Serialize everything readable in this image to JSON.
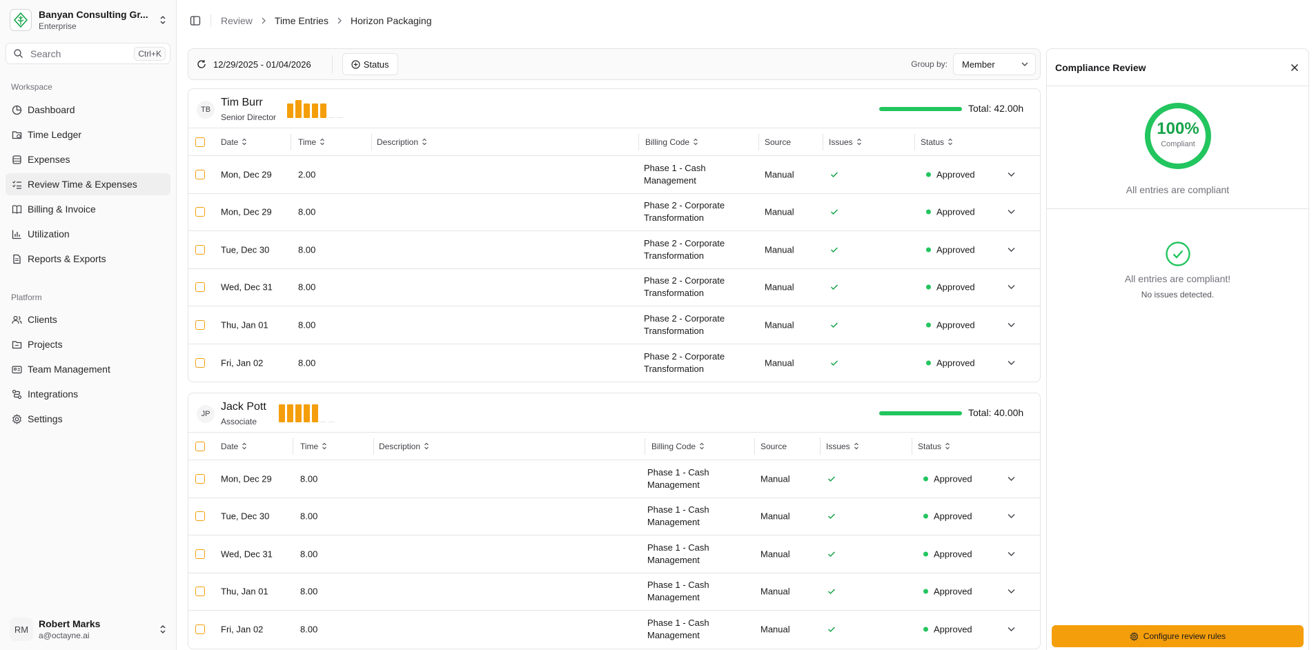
{
  "org": {
    "name": "Banyan Consulting Gr...",
    "plan": "Enterprise"
  },
  "search": {
    "placeholder": "Search",
    "shortcut": "Ctrl+K"
  },
  "sidebar": {
    "workspace_label": "Workspace",
    "platform_label": "Platform",
    "workspace_items": [
      {
        "label": "Dashboard",
        "icon": "chart-pie-icon"
      },
      {
        "label": "Time Ledger",
        "icon": "folder-clock-icon"
      },
      {
        "label": "Expenses",
        "icon": "database-icon"
      },
      {
        "label": "Review Time & Expenses",
        "icon": "list-check-icon"
      },
      {
        "label": "Billing & Invoice",
        "icon": "book-open-icon"
      },
      {
        "label": "Utilization",
        "icon": "chart-bar-icon"
      },
      {
        "label": "Reports & Exports",
        "icon": "file-text-icon"
      }
    ],
    "platform_items": [
      {
        "label": "Clients",
        "icon": "users-icon"
      },
      {
        "label": "Projects",
        "icon": "folder-icon"
      },
      {
        "label": "Team Management",
        "icon": "id-card-icon"
      },
      {
        "label": "Integrations",
        "icon": "integration-icon"
      },
      {
        "label": "Settings",
        "icon": "gear-icon"
      }
    ],
    "active_item": "Review Time & Expenses"
  },
  "user": {
    "initials": "RM",
    "name": "Robert Marks",
    "email": "a@octayne.ai"
  },
  "breadcrumb": [
    "Review",
    "Time Entries",
    "Horizon Packaging"
  ],
  "filters": {
    "date_range": "12/29/2025 - 01/04/2026",
    "status_button": "Status",
    "group_by_label": "Group by:",
    "group_by_value": "Member"
  },
  "columns": [
    "Date",
    "Time",
    "Description",
    "Billing Code",
    "Source",
    "Issues",
    "Status"
  ],
  "groups": [
    {
      "initials": "TB",
      "name": "Tim Burr",
      "role": "Senior Director",
      "total": "Total: 42.00h",
      "progress": 1.0,
      "daily_hours": [
        8,
        10,
        8,
        8,
        8,
        0,
        0
      ],
      "rows": [
        {
          "date": "Mon, Dec 29",
          "time": "2.00",
          "description": "",
          "billing_code": [
            "Phase 1 - Cash",
            "Management"
          ],
          "source": "Manual",
          "status": "Approved"
        },
        {
          "date": "Mon, Dec 29",
          "time": "8.00",
          "description": "",
          "billing_code": [
            "Phase 2 - Corporate",
            "Transformation"
          ],
          "source": "Manual",
          "status": "Approved"
        },
        {
          "date": "Tue, Dec 30",
          "time": "8.00",
          "description": "",
          "billing_code": [
            "Phase 2 - Corporate",
            "Transformation"
          ],
          "source": "Manual",
          "status": "Approved"
        },
        {
          "date": "Wed, Dec 31",
          "time": "8.00",
          "description": "",
          "billing_code": [
            "Phase 2 - Corporate",
            "Transformation"
          ],
          "source": "Manual",
          "status": "Approved"
        },
        {
          "date": "Thu, Jan 01",
          "time": "8.00",
          "description": "",
          "billing_code": [
            "Phase 2 - Corporate",
            "Transformation"
          ],
          "source": "Manual",
          "status": "Approved"
        },
        {
          "date": "Fri, Jan 02",
          "time": "8.00",
          "description": "",
          "billing_code": [
            "Phase 2 - Corporate",
            "Transformation"
          ],
          "source": "Manual",
          "status": "Approved"
        }
      ]
    },
    {
      "initials": "JP",
      "name": "Jack Pott",
      "role": "Associate",
      "total": "Total: 40.00h",
      "progress": 1.0,
      "daily_hours": [
        8,
        8,
        8,
        8,
        8,
        0,
        0
      ],
      "rows": [
        {
          "date": "Mon, Dec 29",
          "time": "8.00",
          "description": "",
          "billing_code": [
            "Phase 1 - Cash",
            "Management"
          ],
          "source": "Manual",
          "status": "Approved"
        },
        {
          "date": "Tue, Dec 30",
          "time": "8.00",
          "description": "",
          "billing_code": [
            "Phase 1 - Cash",
            "Management"
          ],
          "source": "Manual",
          "status": "Approved"
        },
        {
          "date": "Wed, Dec 31",
          "time": "8.00",
          "description": "",
          "billing_code": [
            "Phase 1 - Cash",
            "Management"
          ],
          "source": "Manual",
          "status": "Approved"
        },
        {
          "date": "Thu, Jan 01",
          "time": "8.00",
          "description": "",
          "billing_code": [
            "Phase 1 - Cash",
            "Management"
          ],
          "source": "Manual",
          "status": "Approved"
        },
        {
          "date": "Fri, Jan 02",
          "time": "8.00",
          "description": "",
          "billing_code": [
            "Phase 1 - Cash",
            "Management"
          ],
          "source": "Manual",
          "status": "Approved"
        }
      ]
    }
  ],
  "compliance": {
    "title": "Compliance Review",
    "percent": "100%",
    "percent_value": 1.0,
    "percent_label": "Compliant",
    "summary": "All entries are compliant",
    "ok_title": "All entries are compliant!",
    "ok_subtitle": "No issues detected.",
    "configure_button": "Configure review rules"
  },
  "colors": {
    "accent": "#f59e0b",
    "success": "#22c55e",
    "success_text": "#16a34a",
    "border": "#e4e4e7"
  }
}
